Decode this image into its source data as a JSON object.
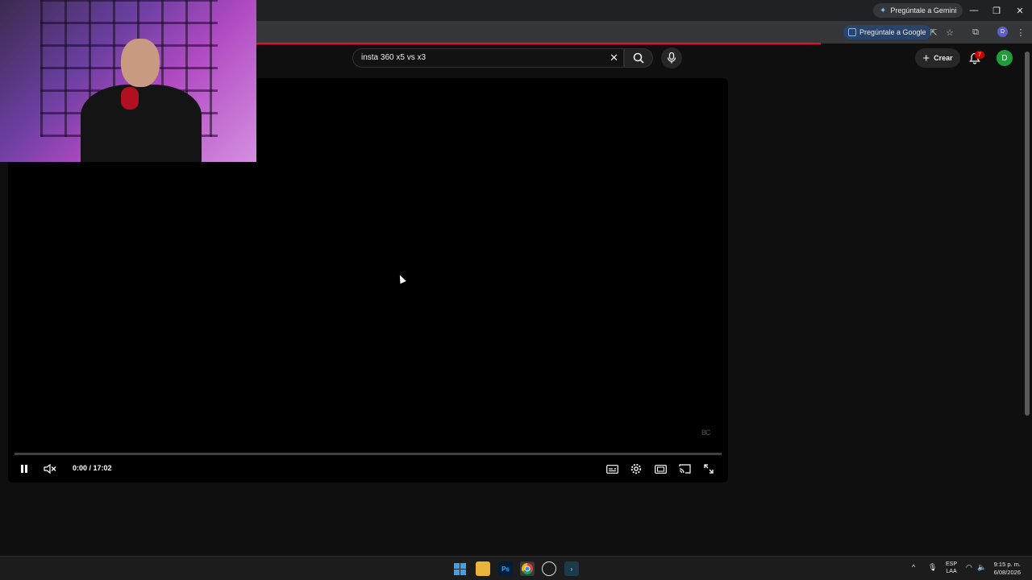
{
  "browser": {
    "gemini_label": "Pregúntale a Gemini",
    "google_label": "Pregúntale a Google",
    "profile_initial": "D"
  },
  "youtube": {
    "search_value": "insta 360 x5 vs x3",
    "create_label": "Crear",
    "notification_count": "7",
    "avatar_initial": "D",
    "accent": "#ff0033"
  },
  "player": {
    "time": "0:00 / 17:02",
    "watermark": "BC",
    "progress": 0
  },
  "taskbar": {
    "photoshop_label": "Ps",
    "language": "ESP",
    "layout": "LAA",
    "time": "9:15 p. m.",
    "date": "6/08/2026"
  }
}
